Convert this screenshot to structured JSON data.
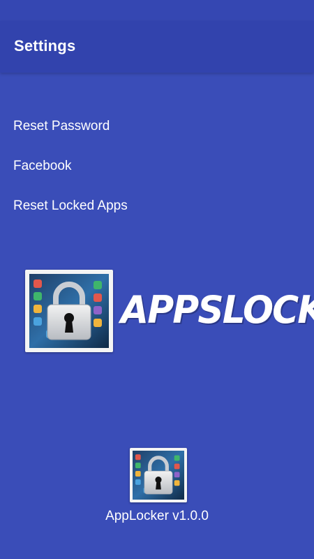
{
  "app_bar": {
    "title": "Settings"
  },
  "menu": {
    "items": [
      {
        "label": "Reset Password"
      },
      {
        "label": "Facebook"
      },
      {
        "label": "Reset Locked Apps"
      }
    ]
  },
  "logo": {
    "icon": "padlock-on-phone-icon",
    "wordmark": "APPSLOCK"
  },
  "footer": {
    "icon": "padlock-on-phone-icon",
    "version": "AppLocker v1.0.0"
  },
  "colors": {
    "background": "#3a4db8",
    "app_bar": "#3243ad",
    "text": "#ffffff"
  }
}
